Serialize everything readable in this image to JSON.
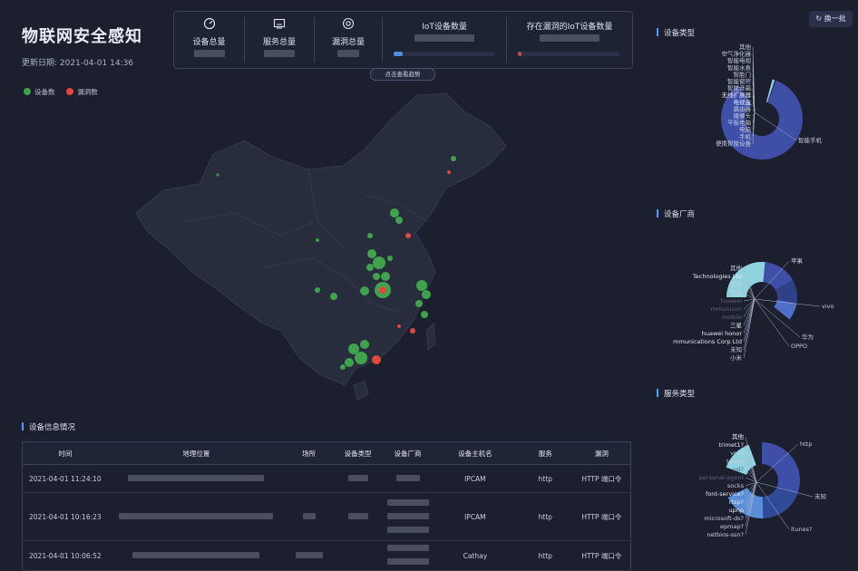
{
  "header": {
    "title": "物联网安全感知",
    "update_label": "更新日期:",
    "update_value": "2021-04-01 14:36",
    "switch_label": "换一批",
    "trend_button": "点击查看趋势"
  },
  "stats": [
    {
      "label": "设备总量",
      "icon": "gauge-icon"
    },
    {
      "label": "服务总量",
      "icon": "screen-icon"
    },
    {
      "label": "漏洞总量",
      "icon": "at-icon"
    },
    {
      "label": "IoT设备数量",
      "icon": ""
    },
    {
      "label": "存在漏洞的IoT设备数量",
      "icon": ""
    }
  ],
  "map": {
    "legend": [
      {
        "label": "设备数",
        "color": "#3fa34d"
      },
      {
        "label": "漏洞数",
        "color": "#e0483e"
      }
    ]
  },
  "panels": {
    "device_type": {
      "title": "设备类型",
      "labels": [
        "其他",
        "空气净化器",
        "智能电视",
        "智能水表",
        "智能门",
        "智能窗帘",
        "智能音箱",
        "无线扩展器",
        "电视盒",
        "路由器",
        "摄像头",
        "平板电脑",
        "电脑",
        "手机",
        "便携智能设备",
        "智能手机"
      ]
    },
    "vendor": {
      "title": "设备厂商",
      "labels": [
        "其他",
        "Technologies Ltd",
        "华为",
        "魅族",
        "huawei",
        "mmunicon",
        "mobile",
        "三星",
        "huawei honor",
        "mmunications Corp Ltd",
        "未知",
        "小米",
        "苹果",
        "vivo",
        "华为",
        "OPPO"
      ]
    },
    "service": {
      "title": "服务类型",
      "labels": [
        "其他",
        "trimet1?",
        "vce?",
        "telnet",
        "ssl?",
        "personal-agent",
        "socks",
        "font-service?",
        "rtsp?",
        "upnp",
        "microsoft-ds?",
        "epmap?",
        "netbios-ssn?",
        "http",
        "未知",
        "itunes?"
      ]
    }
  },
  "table": {
    "title": "设备信息情况",
    "columns": [
      "时间",
      "地理位置",
      "场所",
      "设备类型",
      "设备厂商",
      "设备主机名",
      "服务",
      "漏洞"
    ],
    "rows": [
      {
        "time": "2021-04-01 11:24:10",
        "host": "IPCAM",
        "service": "http",
        "vuln": "HTTP 端口令"
      },
      {
        "time": "2021-04-01 10:16:23",
        "host": "IPCAM",
        "service": "http",
        "vuln": "HTTP 端口令"
      },
      {
        "time": "2021-04-01 10:06:52",
        "host": "Cathay",
        "service": "http",
        "vuln": "HTTP 端口令"
      }
    ]
  },
  "colors": {
    "accent": "#4ea0ff",
    "device": "#3fa34d",
    "vuln": "#e0483e",
    "pie_dark": "#3f4fa8",
    "pie_light": "#8fd3df"
  }
}
